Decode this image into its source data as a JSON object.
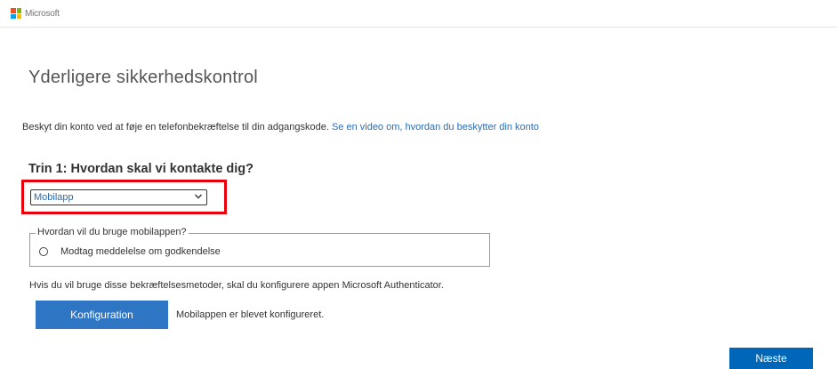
{
  "header": {
    "logo_text": "Microsoft",
    "logo_colors": [
      "#f25022",
      "#7fba00",
      "#00a4ef",
      "#ffb900"
    ]
  },
  "main": {
    "title": "Yderligere sikkerhedskontrol",
    "intro_text": "Beskyt din konto ved at føje en telefonbekræftelse til din adgangskode.",
    "intro_link": "Se en video om, hvordan du beskytter din konto",
    "step_title": "Trin 1: Hvordan skal vi kontakte dig?",
    "contact_method": {
      "selected": "Mobilapp"
    },
    "usage_group": {
      "legend": "Hvordan vil du bruge mobilappen?",
      "option_label": "Modtag meddelelse om godkendelse"
    },
    "helper_text": "Hvis du vil bruge disse bekræftelsesmetoder, skal du konfigurere appen Microsoft Authenticator.",
    "config_button_label": "Konfiguration",
    "config_status": "Mobilappen er blevet konfigureret.",
    "next_button_label": "Næste"
  },
  "colors": {
    "highlight": "#e8000b",
    "button_blue": "#0067b8",
    "link": "#2b6cb0"
  }
}
